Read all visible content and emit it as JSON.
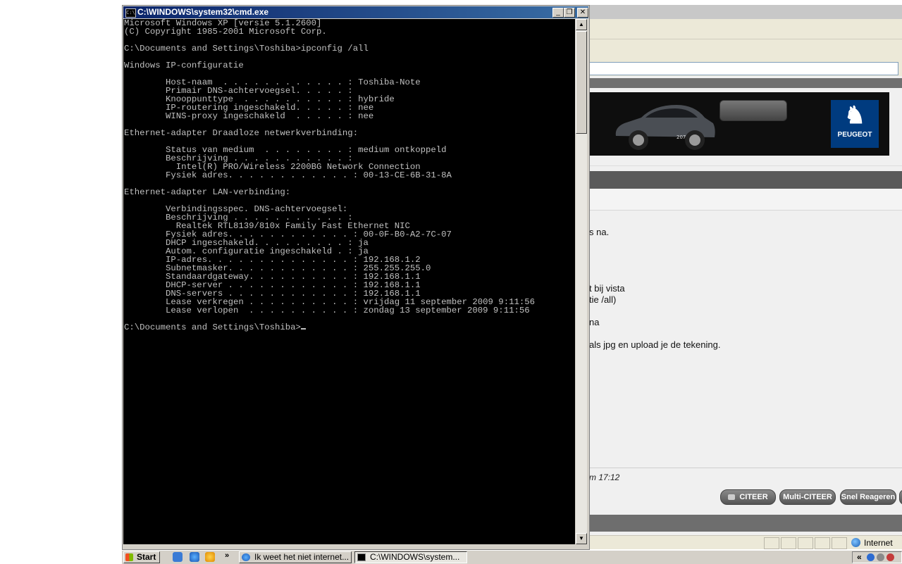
{
  "cmd": {
    "title": "C:\\WINDOWS\\system32\\cmd.exe",
    "icon": "cmd-icon",
    "icon_text": "C:\\",
    "console_lines": [
      "Microsoft Windows XP [versie 5.1.2600]",
      "(C) Copyright 1985-2001 Microsoft Corp.",
      "",
      "C:\\Documents and Settings\\Toshiba>ipconfig /all",
      "",
      "Windows IP-configuratie",
      "",
      "        Host-naam  . . . . . . . . . . . . : Toshiba-Note",
      "        Primair DNS-achtervoegsel. . . . . :",
      "        Knooppunttype  . . . . . . . . . . : hybride",
      "        IP-routering ingeschakeld. . . . . : nee",
      "        WINS-proxy ingeschakeld  . . . . . : nee",
      "",
      "Ethernet-adapter Draadloze netwerkverbinding:",
      "",
      "        Status van medium  . . . . . . . . : medium ontkoppeld",
      "        Beschrijving . . . . . . . . . . . :",
      "          Intel(R) PRO/Wireless 2200BG Network Connection",
      "        Fysiek adres. . . . . . . . . . . . : 00-13-CE-6B-31-8A",
      "",
      "Ethernet-adapter LAN-verbinding:",
      "",
      "        Verbindingsspec. DNS-achtervoegsel:",
      "        Beschrijving . . . . . . . . . . . :",
      "          Realtek RTL8139/810x Family Fast Ethernet NIC",
      "        Fysiek adres. . . . . . . . . . . . : 00-0F-B0-A2-7C-07",
      "        DHCP ingeschakeld. . . . . . . . . : ja",
      "        Autom. configuratie ingeschakeld . : ja",
      "        IP-adres. . . . . . . . . . . . . . : 192.168.1.2",
      "        Subnetmasker. . . . . . . . . . . . : 255.255.255.0",
      "        Standaardgateway. . . . . . . . . . : 192.168.1.1",
      "        DHCP-server . . . . . . . . . . . . : 192.168.1.1",
      "        DNS-servers . . . . . . . . . . . . : 192.168.1.1",
      "        Lease verkregen . . . . . . . . . . : vrijdag 11 september 2009 9:11:56",
      "        Lease verlopen  . . . . . . . . . . : zondag 13 september 2009 9:11:56",
      "",
      "C:\\Documents and Settings\\Toshiba>"
    ],
    "buttons": {
      "minimize": "_",
      "restore": "❐",
      "close": "✕"
    }
  },
  "browser": {
    "banner": {
      "brand": "PEUGEOT",
      "brand_icon": "peugeot-lion-icon",
      "car_badge": "207"
    },
    "post_lines": [
      {
        "text": "s na.",
        "row": 0
      },
      {
        "text": "t bij vista",
        "row": 1
      },
      {
        "text": "tie /all)",
        "row": 2
      },
      {
        "text": "na",
        "row": 3
      },
      {
        "text": "als jpg en upload je de tekening.",
        "row": 4
      }
    ],
    "post_date": "m 17:12",
    "post_buttons": [
      "CITEER",
      "Multi-CITEER",
      "Snel Reageren"
    ],
    "status_zone": "Internet"
  },
  "taskbar": {
    "start_label": "Start",
    "quicklaunch_more": "»",
    "tasks": [
      {
        "label": "Ik weet het niet internet...",
        "icon": "browser-icon",
        "active": false
      },
      {
        "label": "C:\\WINDOWS\\system...",
        "icon": "cmd-icon",
        "active": true
      }
    ],
    "tray_chevron": "«"
  },
  "colors": {
    "console_bg": "#000000",
    "console_fg": "#c0c0c0",
    "titlebar_start": "#0a246a",
    "titlebar_end": "#3a6ea5",
    "peugeot_blue": "#003b7f"
  }
}
